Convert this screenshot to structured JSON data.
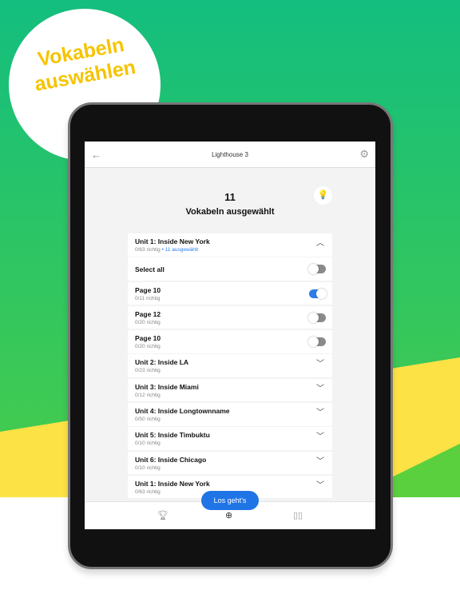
{
  "colors": {
    "bg_green_top": "#13be7e",
    "bg_green_bottom": "#3cc95a",
    "bg_light_green": "#5bd03e",
    "bg_yellow": "#fde245",
    "sticker_text": "#f5c400",
    "accent": "#1f74e6"
  },
  "sticker": {
    "line1": "Vokabeln",
    "line2": "auswählen"
  },
  "header": {
    "title": "Lighthouse 3",
    "back_icon": "arrow-left-icon",
    "settings_icon": "gear-icon"
  },
  "summary": {
    "count": "11",
    "label": "Vokabeln ausgewählt",
    "hint_icon": "lightbulb-icon"
  },
  "list": {
    "unit1": {
      "title": "Unit 1: Inside New York",
      "progress": "0/63 richtig",
      "separator": "•",
      "selected": "11 ausgewählt",
      "expanded": true
    },
    "select_all": {
      "label": "Select all",
      "on": false
    },
    "pages": [
      {
        "title": "Page 10",
        "progress": "0/11 richtig",
        "on": true
      },
      {
        "title": "Page 12",
        "progress": "0/20 richtig",
        "on": false
      },
      {
        "title": "Page 10",
        "progress": "0/20 richtig",
        "on": false
      }
    ],
    "units": [
      {
        "title": "Unit 2: Inside LA",
        "progress": "0/23 richtig"
      },
      {
        "title": "Unit 3: Inside Miami",
        "progress": "0/12 richtig"
      },
      {
        "title": "Unit 4: Inside Longtownname",
        "progress": "0/50 richtig"
      },
      {
        "title": "Unit 5: Inside Timbuktu",
        "progress": "0/10 richtig"
      },
      {
        "title": "Unit 6: Inside Chicago",
        "progress": "0/10 richtig"
      },
      {
        "title": "Unit 1: Inside New York",
        "progress": "0/63 richtig"
      }
    ]
  },
  "cta": {
    "label": "Los geht's"
  },
  "tabbar": {
    "icons": [
      "trophy-icon",
      "plus-circle-icon",
      "book-icon"
    ]
  }
}
